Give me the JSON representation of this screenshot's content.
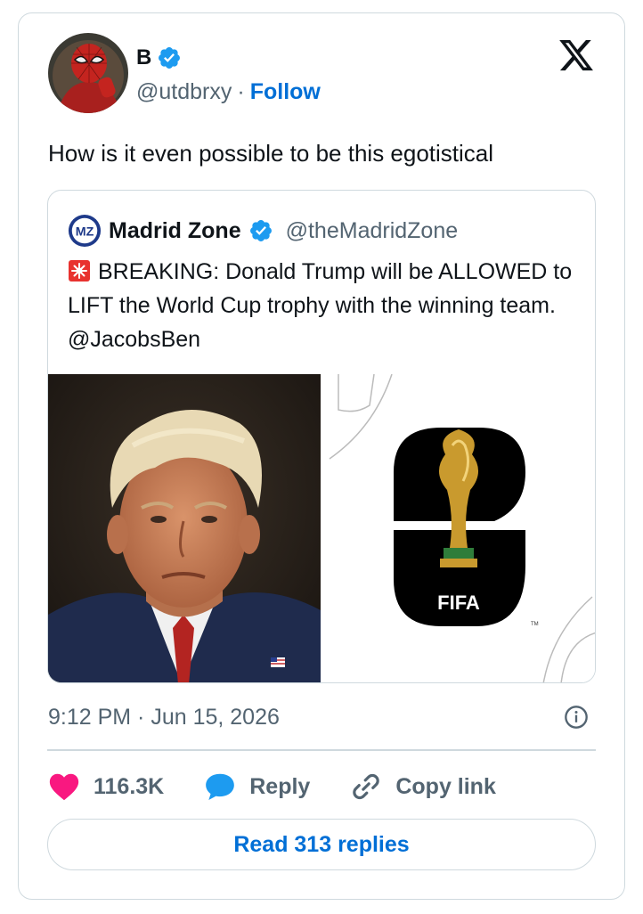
{
  "author": {
    "name": "B",
    "handle": "@utdbrxy",
    "separator": "·",
    "follow_label": "Follow",
    "avatar_icon": "spiderman-avatar",
    "verified_icon": "verified-badge-icon"
  },
  "brand_icon": "x-logo-icon",
  "tweet": {
    "text": "How is it even possible to be this egotistical",
    "timestamp": "9:12 PM · Jun 15, 2026"
  },
  "quoted": {
    "name": "Madrid Zone",
    "handle": "@theMadridZone",
    "logo_icon": "madrid-zone-logo",
    "emoji_icon": "siren-emoji",
    "text": "BREAKING: Donald Trump will be ALLOWED to LIFT the World Cup trophy with the winning team. @JacobsBen",
    "images": [
      {
        "name": "trump-portrait-image"
      },
      {
        "name": "fifa-world-cup-26-logo-image",
        "label": "FIFA",
        "tm": "TM"
      }
    ]
  },
  "actions": {
    "like_count": "116.3K",
    "reply_label": "Reply",
    "copy_link_label": "Copy link",
    "read_replies_label": "Read 313 replies"
  },
  "colors": {
    "accent": "#006fd6",
    "verified": "#1d9bf0",
    "like": "#f91880",
    "reply": "#1d9bf0",
    "text_secondary": "#536471",
    "border": "#cfd9de"
  }
}
